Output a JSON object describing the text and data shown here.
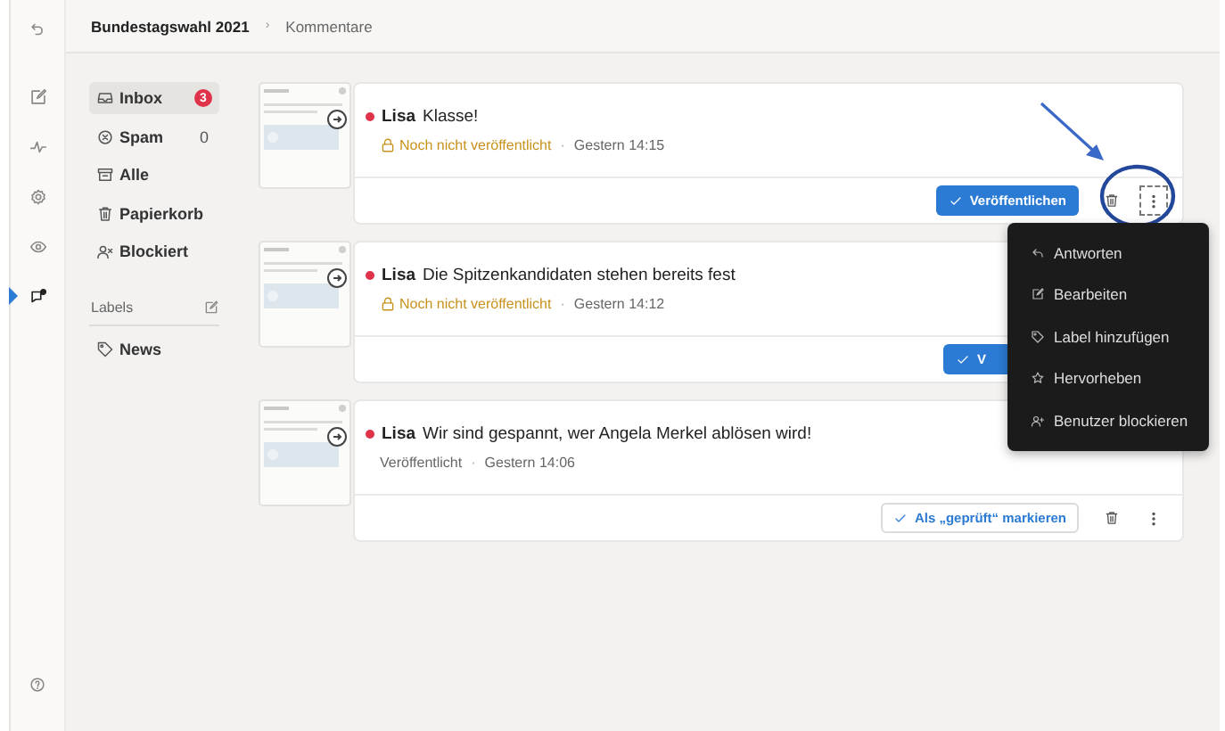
{
  "rail": [
    {
      "selected": false
    },
    {
      "selected": false
    },
    {
      "selected": false
    },
    {
      "selected": false
    },
    {
      "selected": false
    },
    {
      "selected": true
    }
  ],
  "breadcrumb": [
    {
      "label": "Bundestagswahl 2021",
      "current": false
    },
    {
      "label": "Kommentare",
      "current": true
    }
  ],
  "breadcrumb_separator": "›",
  "folders": [
    {
      "label": "Inbox",
      "count": "3",
      "kind": "badge",
      "selected": true
    },
    {
      "label": "Spam",
      "count": "0",
      "kind": "plain",
      "selected": false
    },
    {
      "label": "Alle",
      "selected": false
    },
    {
      "label": "Papierkorb",
      "selected": false
    },
    {
      "label": "Blockiert",
      "selected": false
    }
  ],
  "labels": {
    "title": "Labels",
    "items": [
      {
        "label": "News"
      }
    ]
  },
  "comments": [
    {
      "unread": true,
      "author": "Lisa",
      "text": "Klasse!",
      "published": false,
      "status": "Noch nicht veröffentlicht",
      "separator": "·",
      "time": "Gestern 14:15",
      "action": {
        "kind": "primary",
        "label": "Veröffentlichen"
      },
      "menu_open": true
    },
    {
      "unread": true,
      "author": "Lisa",
      "text": "Die Spitzenkandidaten stehen bereits fest",
      "published": false,
      "status": "Noch nicht veröffentlicht",
      "separator": "·",
      "time": "Gestern 14:12",
      "action": {
        "kind": "primary",
        "label": "V"
      },
      "menu_open": false
    },
    {
      "unread": true,
      "author": "Lisa",
      "text": "Wir sind gespannt, wer Angela Merkel ablösen wird!",
      "published": true,
      "status": "Veröffentlicht",
      "separator": "·",
      "time": "Gestern 14:06",
      "action": {
        "kind": "outline",
        "label": "Als „geprüft“ markieren"
      },
      "menu_open": false
    }
  ],
  "context_menu": {
    "items": [
      {
        "label": "Antworten"
      },
      {
        "label": "Bearbeiten"
      },
      {
        "label": "Label hinzufügen"
      },
      {
        "label": "Hervorheben"
      },
      {
        "label": "Benutzer blockieren"
      }
    ]
  },
  "annotation": {
    "shown": true
  }
}
